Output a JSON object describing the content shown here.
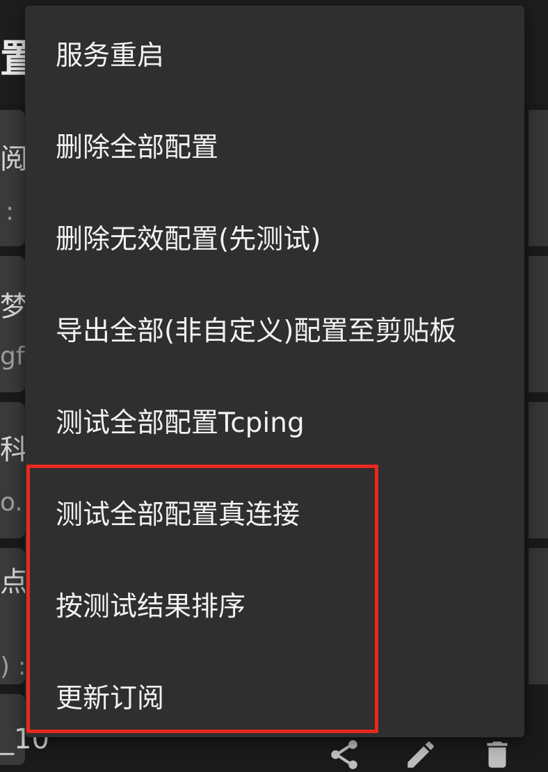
{
  "background": {
    "title_fragment": "置文",
    "cards": [
      {
        "line1": "阅",
        "line2": ":"
      },
      {
        "line1": "梦",
        "line2": "gf"
      },
      {
        "line1": "科扌",
        "line2": "o."
      },
      {
        "line1": "点贝",
        "line2": ") :"
      },
      {
        "line1": "_10",
        "line2": ""
      }
    ],
    "bottom_icons": [
      "share-icon",
      "edit-icon",
      "delete-icon"
    ]
  },
  "menu": {
    "items": [
      {
        "label": "服务重启"
      },
      {
        "label": "删除全部配置"
      },
      {
        "label": "删除无效配置(先测试)"
      },
      {
        "label": "导出全部(非自定义)配置至剪贴板"
      },
      {
        "label": "测试全部配置Tcping"
      },
      {
        "label": "测试全部配置真连接"
      },
      {
        "label": "按测试结果排序"
      },
      {
        "label": "更新订阅"
      }
    ],
    "highlight_color": "#e8291f"
  }
}
